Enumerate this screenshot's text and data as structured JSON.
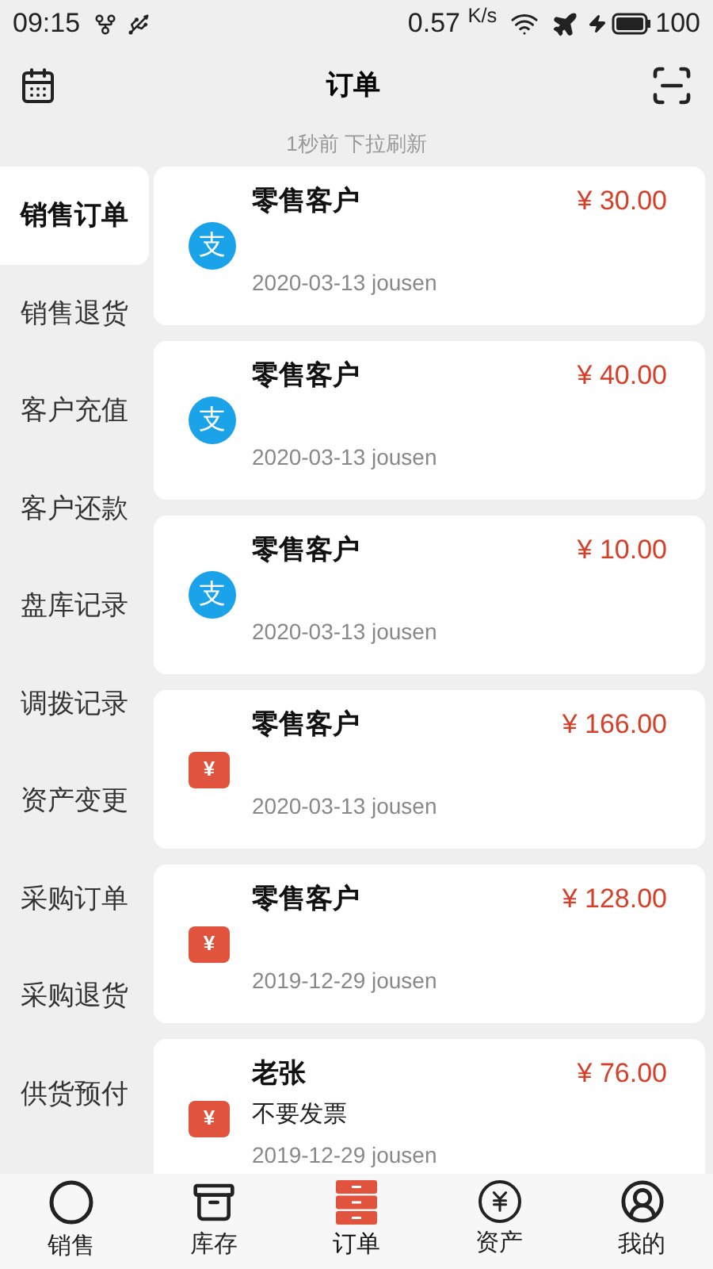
{
  "status_bar": {
    "time": "09:15",
    "speed": "0.57 $^{K/s}$",
    "battery": "100"
  },
  "header": {
    "title": "订单"
  },
  "refresh_hint": "1秒前 下拉刷新",
  "sidebar": {
    "items": [
      {
        "label": "销售订单",
        "selected": true
      },
      {
        "label": "销售退货",
        "selected": false
      },
      {
        "label": "客户充值",
        "selected": false
      },
      {
        "label": "客户还款",
        "selected": false
      },
      {
        "label": "盘库记录",
        "selected": false
      },
      {
        "label": "调拨记录",
        "selected": false
      },
      {
        "label": "资产变更",
        "selected": false
      },
      {
        "label": "采购订单",
        "selected": false
      },
      {
        "label": "采购退货",
        "selected": false
      },
      {
        "label": "供货预付",
        "selected": false
      }
    ]
  },
  "orders": [
    {
      "customer": "零售客户",
      "amount": "¥ 30.00",
      "kind": "alipay",
      "pay_glyph": "支",
      "date_user": "2020-03-13 jousen"
    },
    {
      "customer": "零售客户",
      "amount": "¥ 40.00",
      "kind": "alipay",
      "pay_glyph": "支",
      "date_user": "2020-03-13 jousen"
    },
    {
      "customer": "零售客户",
      "amount": "¥ 10.00",
      "kind": "alipay",
      "pay_glyph": "支",
      "date_user": "2020-03-13 jousen"
    },
    {
      "customer": "零售客户",
      "amount": "¥ 166.00",
      "kind": "cash",
      "pay_glyph": "¥",
      "date_user": "2020-03-13 jousen"
    },
    {
      "customer": "零售客户",
      "amount": "¥ 128.00",
      "kind": "cash",
      "pay_glyph": "¥",
      "date_user": "2019-12-29 jousen"
    },
    {
      "customer": "老张",
      "amount": "¥ 76.00",
      "kind": "cash",
      "pay_glyph": "¥",
      "note": "不要发票",
      "date_user": "2019-12-29 jousen"
    }
  ],
  "bottom_nav": [
    {
      "label": "销售",
      "kind": "sales",
      "selected": false
    },
    {
      "label": "库存",
      "kind": "stock",
      "selected": false
    },
    {
      "label": "订单",
      "kind": "orders",
      "selected": true
    },
    {
      "label": "资产",
      "kind": "assets",
      "selected": false
    },
    {
      "label": "我的",
      "kind": "me",
      "selected": false
    }
  ]
}
